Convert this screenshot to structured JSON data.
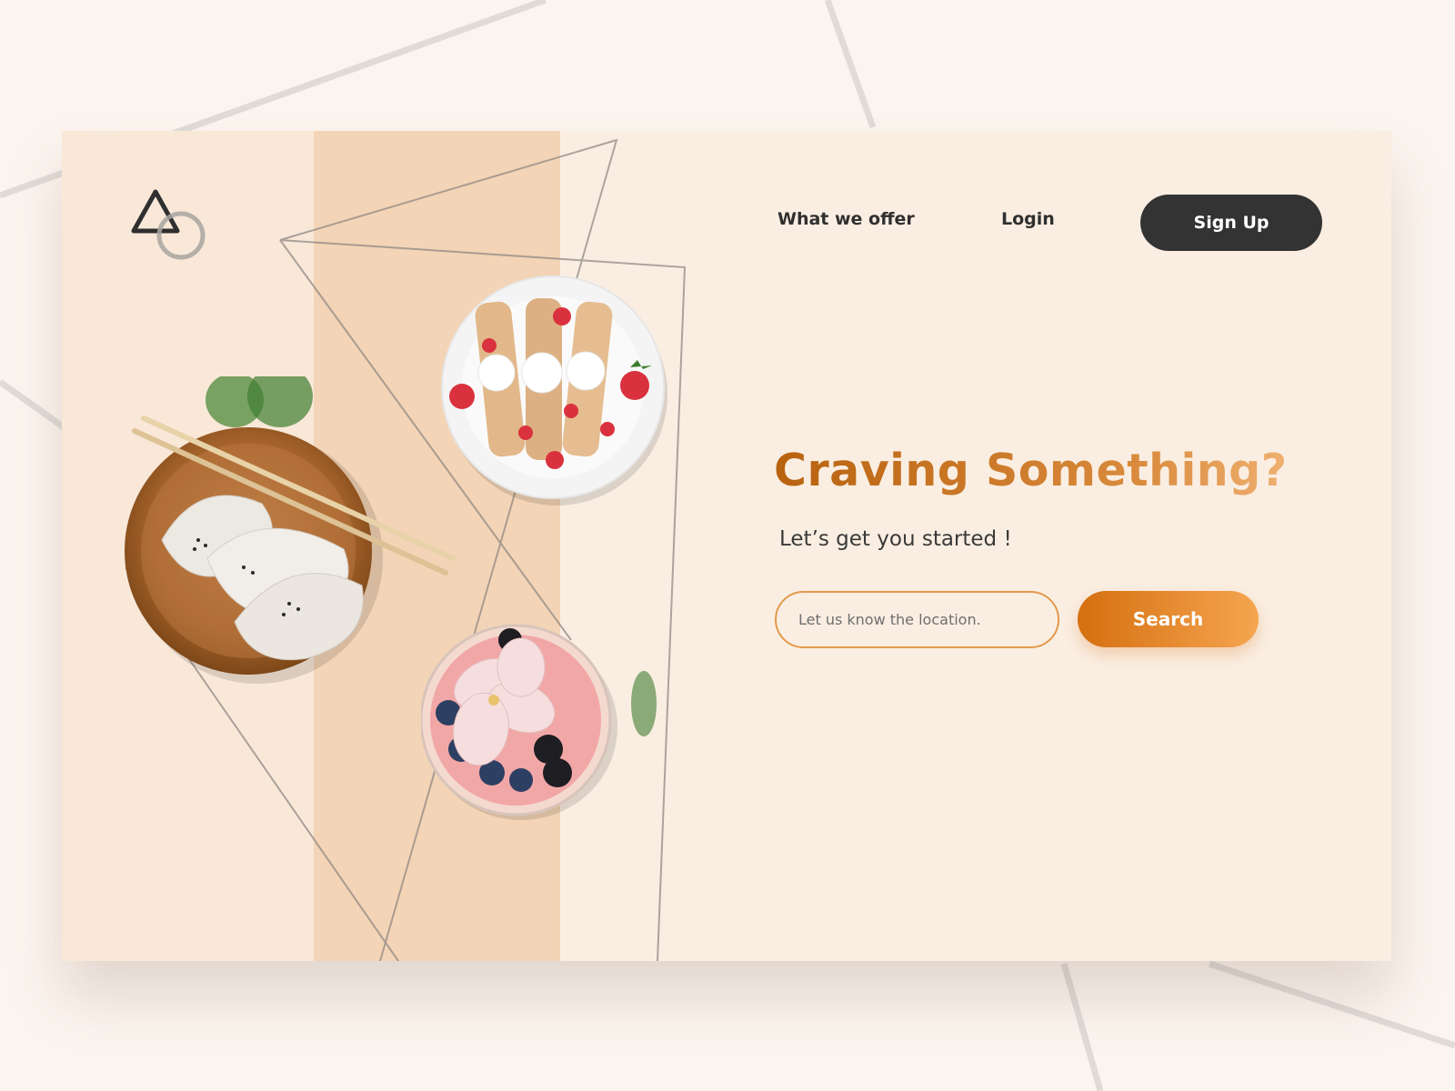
{
  "brand": {
    "logo_icon": "triangle-circle-logo"
  },
  "nav": {
    "offer_label": "What we offer",
    "login_label": "Login",
    "signup_label": "Sign Up"
  },
  "hero": {
    "headline": "Craving Something?",
    "subtitle": "Let’s get you started !",
    "search": {
      "placeholder": "Let us know the location.",
      "value": "",
      "button_label": "Search"
    }
  },
  "images": [
    "dumplings-plate-image",
    "strawberry-crepes-plate-image",
    "smoothie-bowl-image"
  ],
  "colors": {
    "page_background": "#fcf5ef",
    "card_background": "#faeee2",
    "stripe": "#f3d4b6",
    "accent_start": "#d56f10",
    "accent_end": "#f5a550",
    "dark_button": "#333333"
  }
}
